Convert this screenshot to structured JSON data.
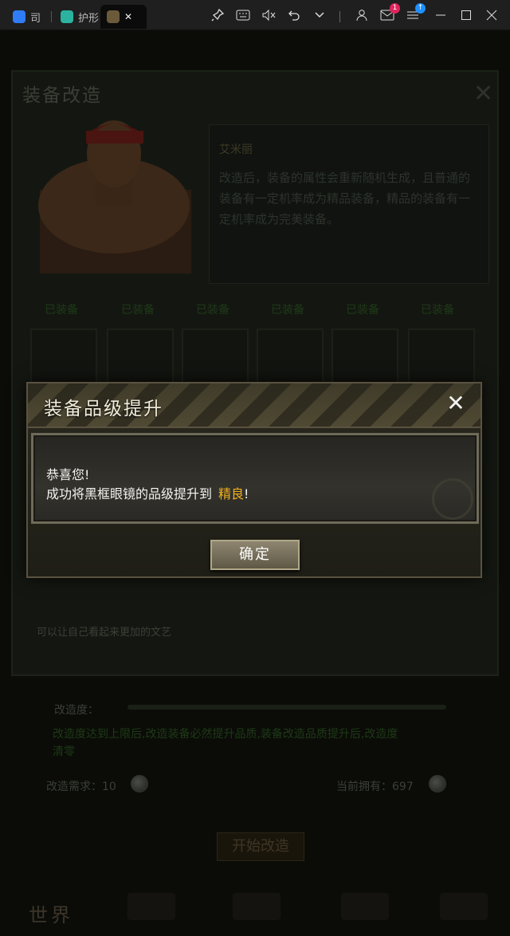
{
  "browser": {
    "tabs": [
      {
        "label": "司",
        "active": false
      },
      {
        "label": "护形",
        "active": false
      },
      {
        "label": "",
        "active": true
      }
    ],
    "controls": [
      "pin-icon",
      "keyboard-icon",
      "mute-icon",
      "undo-icon",
      "chevron-down-icon",
      "user-icon",
      "mail-icon",
      "menu-icon",
      "minimize-icon",
      "maximize-icon",
      "close-icon"
    ],
    "mail_badge": "1",
    "menu_badge": "↑",
    "close_glyph": "✕"
  },
  "background": {
    "title": "装备改造",
    "npc_name": "艾米丽",
    "npc_desc": "改造后，装备的属性会重新随机生成，且普通的装备有一定机率成为精品装备，精品的装备有一定机率成为完美装备。",
    "slots": [
      "已装备",
      "已装备",
      "已装备",
      "已装备",
      "已装备",
      "已装备"
    ],
    "tip": "可以让自己看起来更加的文艺",
    "progress_label": "改造度：",
    "progress_note": "改造度达到上限后,改造装备必然提升品质,装备改造品质提升后,改造度清零",
    "requirement": "改造需求：10",
    "owned": "当前拥有：697",
    "start_button": "开始改造",
    "world_label": "世界"
  },
  "modal": {
    "title": "装备品级提升",
    "close_glyph": "✕",
    "line1": "恭喜您!",
    "line2_prefix": "成功将黑框眼镜的品级提升到",
    "line2_highlight": "精良",
    "line2_suffix": "!",
    "ok_button": "确定"
  },
  "colors": {
    "highlight": "#f0b020",
    "modal_border": "#5a5240"
  }
}
